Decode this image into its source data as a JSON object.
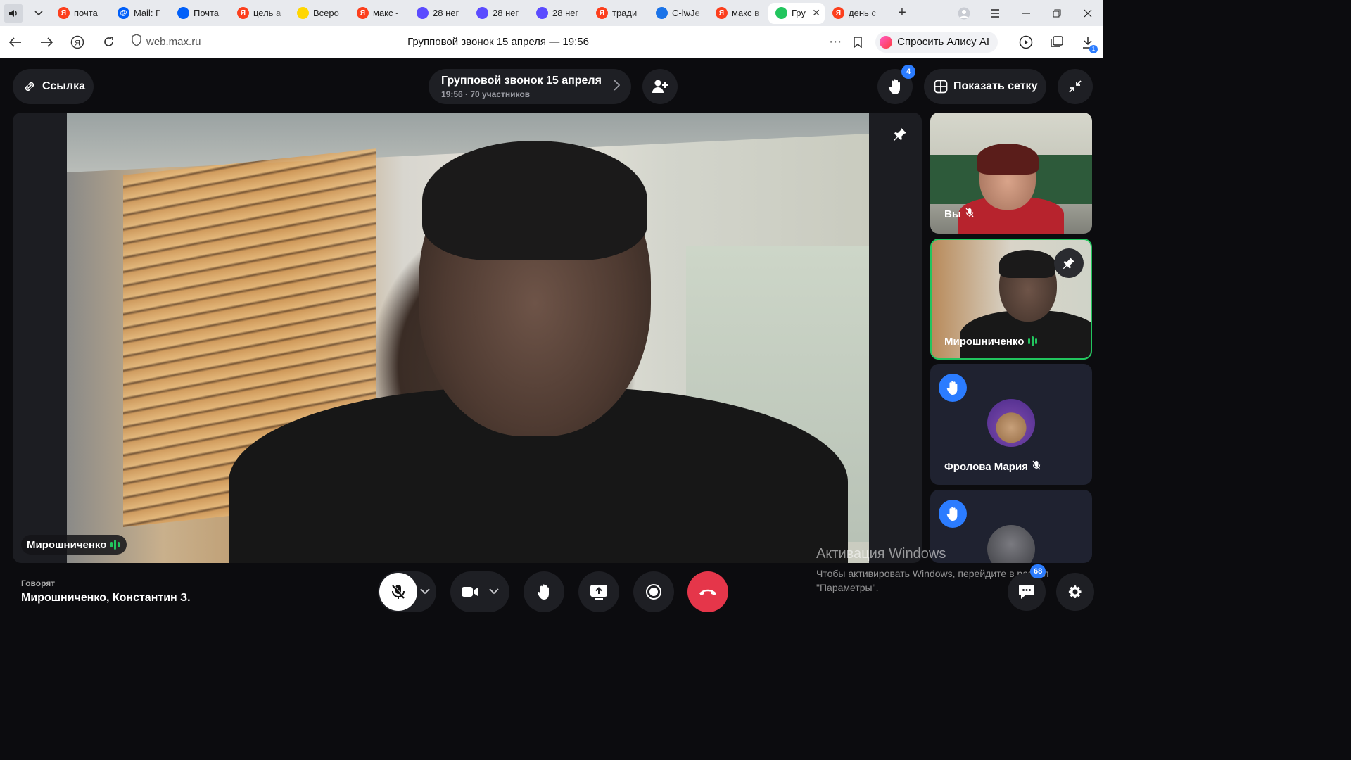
{
  "browser": {
    "tabs": [
      {
        "title": "почта",
        "icon": "yandex-icon",
        "color": "#fc3f1d"
      },
      {
        "title": "Mail: Г",
        "icon": "mail-ru-icon",
        "color": "#005ff9"
      },
      {
        "title": "Почта",
        "icon": "mail-icon",
        "color": "#005ff9"
      },
      {
        "title": "цель а",
        "icon": "yandex-icon",
        "color": "#fc3f1d"
      },
      {
        "title": "Всеро",
        "icon": "bookmark-icon",
        "color": "#ffd600"
      },
      {
        "title": "макс -",
        "icon": "yandex-icon",
        "color": "#fc3f1d"
      },
      {
        "title": "28 нег",
        "icon": "max-icon",
        "color": "#5b4bff"
      },
      {
        "title": "28 нег",
        "icon": "max-icon",
        "color": "#5b4bff"
      },
      {
        "title": "28 нег",
        "icon": "max-icon",
        "color": "#5b4bff"
      },
      {
        "title": "тради",
        "icon": "yandex-icon",
        "color": "#fc3f1d"
      },
      {
        "title": "C-lwJe",
        "icon": "disk-icon",
        "color": "#1a73e8"
      },
      {
        "title": "макс в",
        "icon": "yandex-icon",
        "color": "#fc3f1d"
      },
      {
        "title": "Гру",
        "icon": "phone-icon",
        "color": "#22c55e",
        "active": true
      },
      {
        "title": "день с",
        "icon": "yandex-icon",
        "color": "#fc3f1d"
      }
    ],
    "url": "web.max.ru",
    "page_title": "Групповой звонок 15 апреля — 19:56",
    "alice_label": "Спросить Алису AI"
  },
  "call": {
    "link_label": "Ссылка",
    "title": "Групповой звонок 15 апреля",
    "subtitle": "19:56 · 70 участников",
    "raised_hands_count": "4",
    "grid_label": "Показать сетку",
    "main_speaker": "Мирошниченко",
    "participants": [
      {
        "name": "Вы",
        "muted": true
      },
      {
        "name": "Мирошниченко",
        "speaking": true,
        "pinned": true
      },
      {
        "name": "Фролова Мария",
        "muted": true,
        "hand_raised": true
      },
      {
        "name": "",
        "hand_raised": true
      }
    ],
    "speaking_label": "Говорят",
    "speaking_names": "Мирошниченко, Константин З.",
    "chat_count": "68"
  },
  "watermark": {
    "title": "Активация Windows",
    "text": "Чтобы активировать Windows, перейдите в раздел \"Параметры\"."
  },
  "colors": {
    "accent": "#2b7cff",
    "speaking": "#22c55e",
    "end_call": "#e5364a"
  }
}
